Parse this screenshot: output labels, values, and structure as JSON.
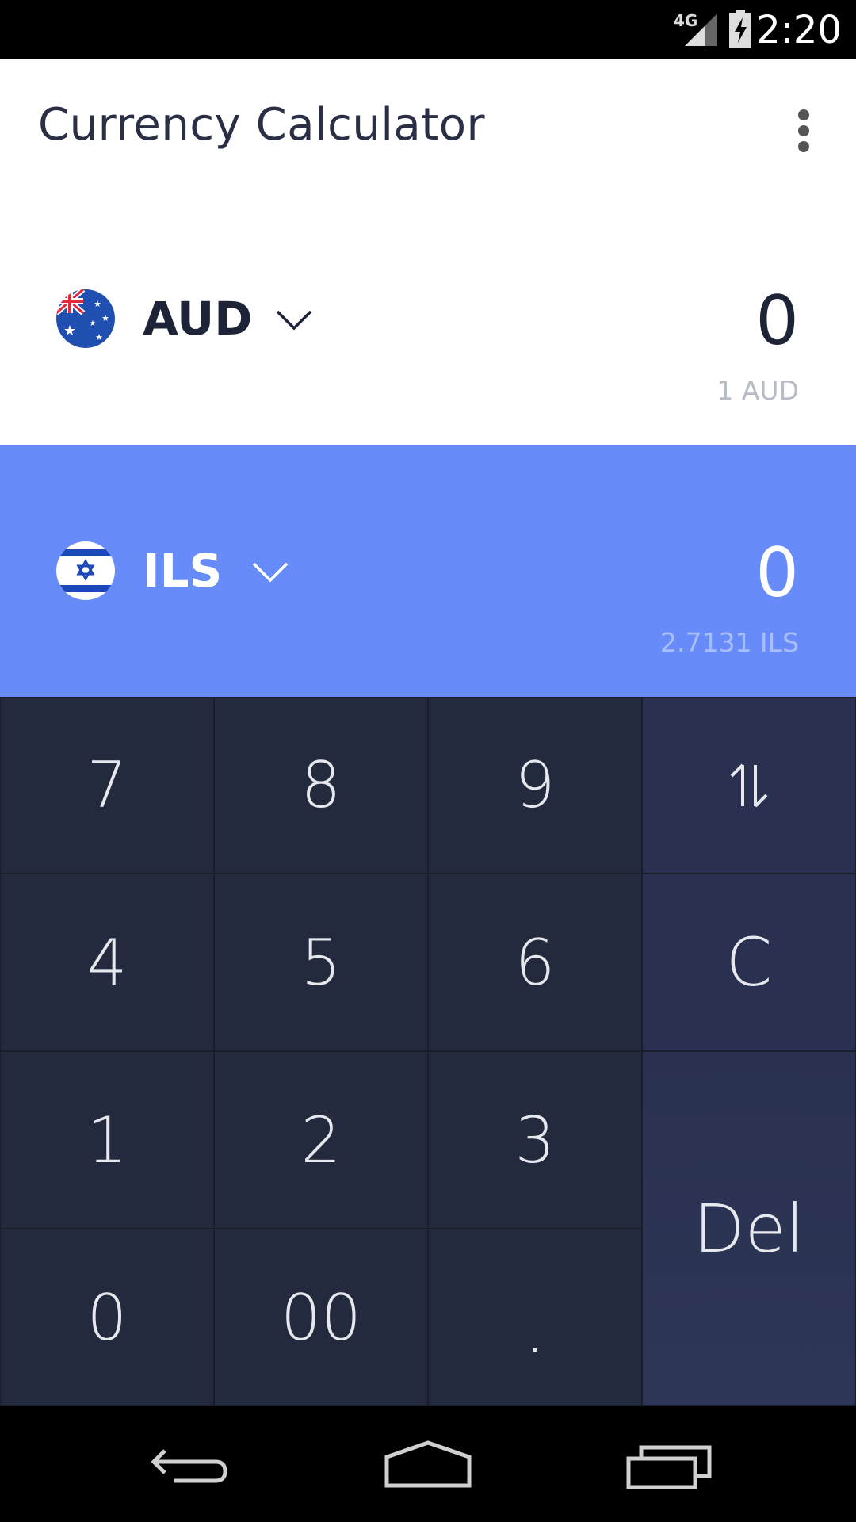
{
  "status": {
    "network": "4G",
    "time": "2:20"
  },
  "app": {
    "title": "Currency Calculator"
  },
  "from": {
    "code": "AUD",
    "amount": "0",
    "rate": "1 AUD",
    "flag": "australia-flag"
  },
  "to": {
    "code": "ILS",
    "amount": "0",
    "rate": "2.7131 ILS",
    "flag": "israel-flag"
  },
  "keypad": {
    "k7": "7",
    "k8": "8",
    "k9": "9",
    "k4": "4",
    "k5": "5",
    "k6": "6",
    "k1": "1",
    "k2": "2",
    "k3": "3",
    "k0": "0",
    "k00": "00",
    "kdot": ".",
    "swap_icon": "swap-vertical-icon",
    "clear": "C",
    "delete": "Del"
  },
  "colors": {
    "accent": "#678cfa",
    "keypad_bg": "#242a3d",
    "keypad_op_bg": "#2a3150"
  }
}
